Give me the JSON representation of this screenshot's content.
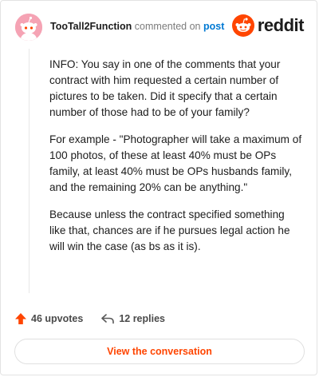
{
  "header": {
    "username": "TooTall2Function",
    "commented_on": "commented on",
    "post_link": "post",
    "brand": "reddit",
    "avatar_icon": "snoo-avatar-icon",
    "brand_icon": "reddit-alien-icon"
  },
  "comment": {
    "paragraphs": [
      "INFO: You say in one of the comments that your contract with him requested a certain number of pictures to be taken. Did it specify that a certain number of those had to be of your family?",
      "For example - \"Photographer will take a maximum of 100 photos, of these at least 40% must be OPs family, at least 40% must be OPs husbands family, and the remaining 20% can be anything.\"",
      "Because unless the contract specified something like that, chances are if he pursues legal action he will win the case (as bs as it is)."
    ]
  },
  "actions": {
    "upvotes": "46 upvotes",
    "replies": "12 replies",
    "upvote_icon": "upvote-arrow-icon",
    "reply_icon": "reply-arrow-icon"
  },
  "footer": {
    "view_conversation": "View the conversation"
  },
  "colors": {
    "accent": "#ff4500",
    "link": "#0079d3",
    "avatar_bg": "#f5a3b4"
  }
}
